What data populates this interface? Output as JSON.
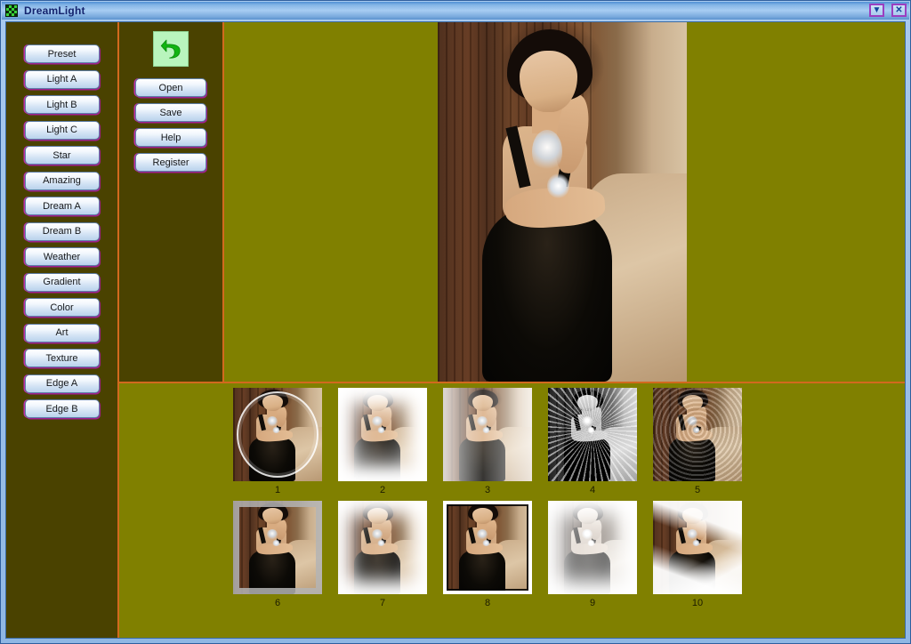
{
  "window": {
    "title": "DreamLight",
    "icon": "app-pattern-icon",
    "buttons": [
      {
        "name": "minimize",
        "glyph": "▼"
      },
      {
        "name": "close",
        "glyph": "✕"
      }
    ]
  },
  "colors": {
    "canvas_olive": "#808000",
    "panel_dark_olive": "#4a4200",
    "divider_orange": "#d2691e",
    "titlebar_blue": "#84b5e6",
    "button_accent_magenta": "#c030a8",
    "undo_icon_green": "#11b411",
    "undo_bg_green": "#b9f5bd"
  },
  "sidebar": {
    "items": [
      {
        "label": "Preset"
      },
      {
        "label": "Light A"
      },
      {
        "label": "Light B"
      },
      {
        "label": "Light C"
      },
      {
        "label": "Star"
      },
      {
        "label": "Amazing"
      },
      {
        "label": "Dream A"
      },
      {
        "label": "Dream B"
      },
      {
        "label": "Weather"
      },
      {
        "label": "Gradient"
      },
      {
        "label": "Color"
      },
      {
        "label": "Art"
      },
      {
        "label": "Texture"
      },
      {
        "label": "Edge A"
      },
      {
        "label": "Edge B"
      }
    ]
  },
  "toolbar": {
    "undo_icon": "undo-arrow-icon",
    "buttons": [
      {
        "label": "Open"
      },
      {
        "label": "Save"
      },
      {
        "label": "Help"
      },
      {
        "label": "Register"
      }
    ]
  },
  "preview": {
    "image_alt": "portrait-photo-woman-black-dress"
  },
  "thumbnails": {
    "rows": [
      [
        {
          "label": "1",
          "effect": "circle-frame"
        },
        {
          "label": "2",
          "effect": "white-vignette"
        },
        {
          "label": "3",
          "effect": "sketch-wash"
        },
        {
          "label": "4",
          "effect": "radial-rays-mono"
        },
        {
          "label": "5",
          "effect": "zoom-blur-swirl"
        }
      ],
      [
        {
          "label": "6",
          "effect": "gray-frame"
        },
        {
          "label": "7",
          "effect": "soft-feather"
        },
        {
          "label": "8",
          "effect": "rough-edge-border"
        },
        {
          "label": "9",
          "effect": "high-key-fade"
        },
        {
          "label": "10",
          "effect": "brush-stroke-mask"
        }
      ]
    ]
  }
}
